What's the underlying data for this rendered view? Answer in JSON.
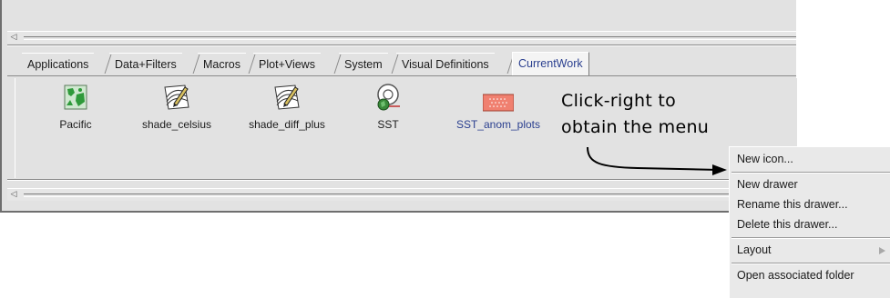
{
  "tabs": [
    {
      "label": "Applications"
    },
    {
      "label": "Data+Filters"
    },
    {
      "label": "Macros"
    },
    {
      "label": "Plot+Views"
    },
    {
      "label": "System"
    },
    {
      "label": "Visual Definitions"
    },
    {
      "label": "CurrentWork",
      "active": true
    }
  ],
  "icons": [
    {
      "label": "Pacific",
      "icon": "map-icon"
    },
    {
      "label": "shade_celsius",
      "icon": "contour-edit-icon"
    },
    {
      "label": "shade_diff_plus",
      "icon": "contour-edit-icon"
    },
    {
      "label": "SST",
      "icon": "globe-data-icon"
    },
    {
      "label": "SST_anom_plots",
      "icon": "folder-work-icon"
    }
  ],
  "annotation": {
    "line1": "Click-right to",
    "line2": "obtain the menu"
  },
  "context_menu": {
    "items": [
      {
        "label": "New icon..."
      },
      {
        "label": "New drawer"
      },
      {
        "label": "Rename this drawer..."
      },
      {
        "label": "Delete this drawer..."
      },
      {
        "label": "Layout",
        "submenu": true
      },
      {
        "label": "Open associated folder"
      }
    ]
  },
  "colors": {
    "window_bg": "#e2e2e2",
    "active_tab_text": "#2a3f8f",
    "menu_bg": "#e9e9e9"
  }
}
